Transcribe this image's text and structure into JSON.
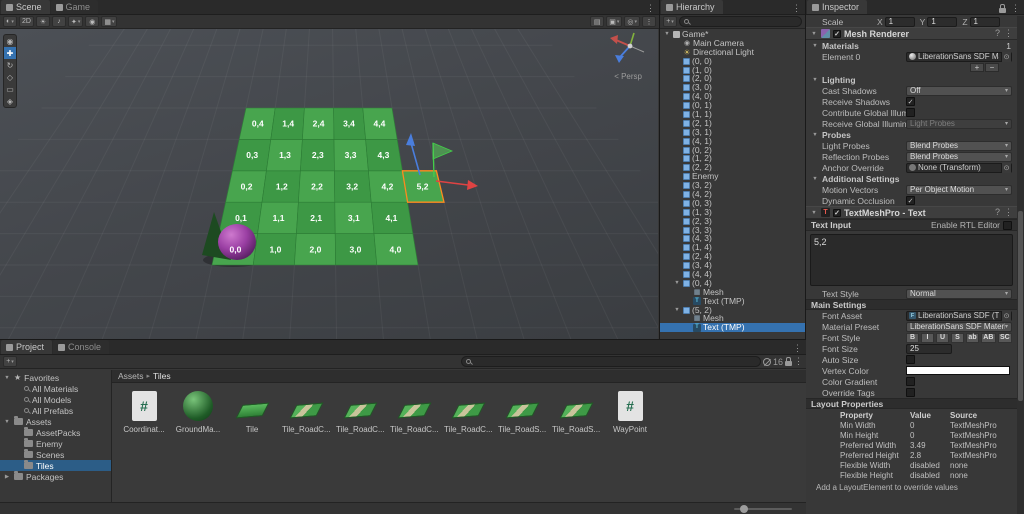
{
  "scene_area": {
    "tabs": [
      {
        "label": "Scene",
        "active": true
      },
      {
        "label": "Game",
        "active": false
      }
    ],
    "toolbar_left": [
      {
        "name": "shading-mode",
        "glyph": "◐",
        "drop": true
      },
      {
        "name": "2d-view",
        "glyph": "2D",
        "drop": false
      },
      {
        "name": "scene-lighting",
        "glyph": "☀",
        "drop": false
      },
      {
        "name": "scene-audio",
        "glyph": "♪",
        "drop": false
      },
      {
        "name": "effects",
        "glyph": "✦",
        "drop": true
      },
      {
        "name": "scene-visibility",
        "glyph": "◉",
        "drop": false
      },
      {
        "name": "grid-visibility",
        "glyph": "▦",
        "drop": true
      }
    ],
    "toolbar_right": [
      {
        "name": "render-stats",
        "glyph": "▤",
        "drop": false
      },
      {
        "name": "camera-settings",
        "glyph": "▣",
        "drop": true
      },
      {
        "name": "gizmos",
        "glyph": "◎",
        "drop": true
      },
      {
        "name": "scene-more",
        "glyph": "⋮",
        "drop": false
      }
    ],
    "tools": [
      {
        "name": "view-tool",
        "glyph": "◉",
        "active": false
      },
      {
        "name": "move-tool",
        "glyph": "✚",
        "active": true
      },
      {
        "name": "rotate-tool",
        "glyph": "↻",
        "active": false
      },
      {
        "name": "scale-tool",
        "glyph": "◇",
        "active": false
      },
      {
        "name": "rect-tool",
        "glyph": "▭",
        "active": false
      },
      {
        "name": "transform-tool",
        "glyph": "◈",
        "active": false
      }
    ],
    "persp_label": "< Persp",
    "tile_rows": [
      [
        "0,4",
        "1,4",
        "2,4",
        "3,4",
        "4,4"
      ],
      [
        "0,3",
        "1,3",
        "2,3",
        "3,3",
        "4,3"
      ],
      [
        "0,2",
        "1,2",
        "2,2",
        "3,2",
        "4,2"
      ],
      [
        "0,1",
        "1,1",
        "2,1",
        "3,1",
        "4,1"
      ],
      [
        "0,0",
        "1,0",
        "2,0",
        "3,0",
        "4,0"
      ]
    ],
    "selected_tile": "5,2"
  },
  "hierarchy": {
    "tab": "Hierarchy",
    "create_label": "+",
    "items": [
      {
        "label": "Game*",
        "icon": "scene",
        "depth": 0,
        "fold": "open"
      },
      {
        "label": "Main Camera",
        "icon": "camera",
        "depth": 1
      },
      {
        "label": "Directional Light",
        "icon": "light",
        "depth": 1
      },
      {
        "label": "(0, 0)",
        "icon": "prefab",
        "depth": 1
      },
      {
        "label": "(1, 0)",
        "icon": "prefab",
        "depth": 1
      },
      {
        "label": "(2, 0)",
        "icon": "prefab",
        "depth": 1
      },
      {
        "label": "(3, 0)",
        "icon": "prefab",
        "depth": 1
      },
      {
        "label": "(4, 0)",
        "icon": "prefab",
        "depth": 1
      },
      {
        "label": "(0, 1)",
        "icon": "prefab",
        "depth": 1
      },
      {
        "label": "(1, 1)",
        "icon": "prefab",
        "depth": 1
      },
      {
        "label": "(2, 1)",
        "icon": "prefab",
        "depth": 1
      },
      {
        "label": "(3, 1)",
        "icon": "prefab",
        "depth": 1
      },
      {
        "label": "(4, 1)",
        "icon": "prefab",
        "depth": 1
      },
      {
        "label": "(0, 2)",
        "icon": "prefab",
        "depth": 1
      },
      {
        "label": "(1, 2)",
        "icon": "prefab",
        "depth": 1
      },
      {
        "label": "(2, 2)",
        "icon": "prefab",
        "depth": 1
      },
      {
        "label": "Enemy",
        "icon": "prefab",
        "depth": 1
      },
      {
        "label": "(3, 2)",
        "icon": "prefab",
        "depth": 1
      },
      {
        "label": "(4, 2)",
        "icon": "prefab",
        "depth": 1
      },
      {
        "label": "(0, 3)",
        "icon": "prefab",
        "depth": 1
      },
      {
        "label": "(1, 3)",
        "icon": "prefab",
        "depth": 1
      },
      {
        "label": "(2, 3)",
        "icon": "prefab",
        "depth": 1
      },
      {
        "label": "(3, 3)",
        "icon": "prefab",
        "depth": 1
      },
      {
        "label": "(4, 3)",
        "icon": "prefab",
        "depth": 1
      },
      {
        "label": "(1, 4)",
        "icon": "prefab",
        "depth": 1
      },
      {
        "label": "(2, 4)",
        "icon": "prefab",
        "depth": 1
      },
      {
        "label": "(3, 4)",
        "icon": "prefab",
        "depth": 1
      },
      {
        "label": "(4, 4)",
        "icon": "prefab",
        "depth": 1
      },
      {
        "label": "(0, 4)",
        "icon": "prefab",
        "depth": 1,
        "fold": "open"
      },
      {
        "label": "Mesh",
        "icon": "mesh",
        "depth": 2
      },
      {
        "label": "Text (TMP)",
        "icon": "text",
        "depth": 2
      },
      {
        "label": "(5, 2)",
        "icon": "prefab",
        "depth": 1,
        "fold": "open"
      },
      {
        "label": "Mesh",
        "icon": "mesh",
        "depth": 2
      },
      {
        "label": "Text (TMP)",
        "icon": "text",
        "depth": 2,
        "selected": true
      }
    ]
  },
  "inspector": {
    "tab": "Inspector",
    "transform_scale": {
      "label": "Scale",
      "x": "1",
      "y": "1",
      "z": "1"
    },
    "mesh_renderer": {
      "title": "Mesh Renderer",
      "materials": {
        "label": "Materials",
        "count": "1",
        "add_label": "+",
        "remove_label": "−",
        "elements": [
          {
            "label": "Element 0",
            "value": "LiberationSans SDF Material"
          }
        ]
      },
      "lighting": {
        "label": "Lighting",
        "rows": [
          {
            "label": "Cast Shadows",
            "control": "dropdown",
            "value": "Off"
          },
          {
            "label": "Receive Shadows",
            "control": "checkbox",
            "checked": true
          },
          {
            "label": "Contribute Global Illumi",
            "control": "checkbox",
            "checked": false
          },
          {
            "label": "Receive Global Illumina",
            "control": "dropdown",
            "value": "Light Probes",
            "disabled": true
          }
        ]
      },
      "probes": {
        "label": "Probes",
        "rows": [
          {
            "label": "Light Probes",
            "control": "dropdown",
            "value": "Blend Probes"
          },
          {
            "label": "Reflection Probes",
            "control": "dropdown",
            "value": "Blend Probes"
          },
          {
            "label": "Anchor Override",
            "control": "object",
            "value": "None (Transform)",
            "icon": "none"
          }
        ]
      },
      "additional": {
        "label": "Additional Settings",
        "rows": [
          {
            "label": "Motion Vectors",
            "control": "dropdown",
            "value": "Per Object Motion"
          },
          {
            "label": "Dynamic Occlusion",
            "control": "checkbox",
            "checked": true
          }
        ]
      }
    },
    "tmp_text": {
      "title": "TextMeshPro - Text",
      "text_input_label": "Text Input",
      "rtl_label": "Enable RTL Editor",
      "text_value": "5,2",
      "text_style_label": "Text Style",
      "text_style_value": "Normal",
      "main_settings_label": "Main Settings",
      "rows": [
        {
          "label": "Font Asset",
          "control": "object",
          "value": "LiberationSans SDF (TMP_Font As",
          "icon": "font"
        },
        {
          "label": "Material Preset",
          "control": "dropdown",
          "value": "LiberationSans SDF Material"
        },
        {
          "label": "Font Style",
          "control": "buttons",
          "buttons": [
            "B",
            "I",
            "U",
            "S",
            "ab",
            "AB",
            "SC"
          ]
        },
        {
          "label": "Font Size",
          "control": "input",
          "value": "25"
        },
        {
          "label": "Auto Size",
          "control": "checkbox",
          "checked": false
        },
        {
          "label": "Vertex Color",
          "control": "color",
          "value": "#FFFFFF"
        },
        {
          "label": "Color Gradient",
          "control": "checkbox",
          "checked": false
        },
        {
          "label": "Override Tags",
          "control": "checkbox",
          "checked": false
        }
      ]
    },
    "layout_properties": {
      "title": "Layout Properties",
      "headers": [
        "Property",
        "Value",
        "Source"
      ],
      "rows": [
        [
          "Min Width",
          "0",
          "TextMeshPro"
        ],
        [
          "Min Height",
          "0",
          "TextMeshPro"
        ],
        [
          "Preferred Width",
          "3.49",
          "TextMeshPro"
        ],
        [
          "Preferred Height",
          "2.8",
          "TextMeshPro"
        ],
        [
          "Flexible Width",
          "disabled",
          "none"
        ],
        [
          "Flexible Height",
          "disabled",
          "none"
        ]
      ],
      "footer": "Add a LayoutElement to override values"
    }
  },
  "project": {
    "tabs": [
      {
        "label": "Project",
        "active": true
      },
      {
        "label": "Console",
        "active": false
      }
    ],
    "create_label": "+",
    "favorites": {
      "label": "Favorites",
      "items": [
        "All Materials",
        "All Models",
        "All Prefabs"
      ]
    },
    "assets_root": {
      "label": "Assets",
      "items": [
        {
          "label": "AssetPacks"
        },
        {
          "label": "Enemy"
        },
        {
          "label": "Scenes"
        },
        {
          "label": "Tiles",
          "selected": true
        }
      ]
    },
    "packages_label": "Packages",
    "breadcrumb": [
      "Assets",
      "Tiles"
    ],
    "hidden_count": "16",
    "items": [
      {
        "label": "Coordinat...",
        "type": "script"
      },
      {
        "label": "GroundMa...",
        "type": "material"
      },
      {
        "label": "Tile",
        "type": "tile",
        "road": false
      },
      {
        "label": "Tile_RoadC...",
        "type": "tile",
        "road": true
      },
      {
        "label": "Tile_RoadC...",
        "type": "tile",
        "road": true
      },
      {
        "label": "Tile_RoadC...",
        "type": "tile",
        "road": true
      },
      {
        "label": "Tile_RoadC...",
        "type": "tile",
        "road": true
      },
      {
        "label": "Tile_RoadS...",
        "type": "tile",
        "road": true
      },
      {
        "label": "Tile_RoadS...",
        "type": "tile",
        "road": true
      },
      {
        "label": "WayPoint",
        "type": "script"
      }
    ]
  }
}
